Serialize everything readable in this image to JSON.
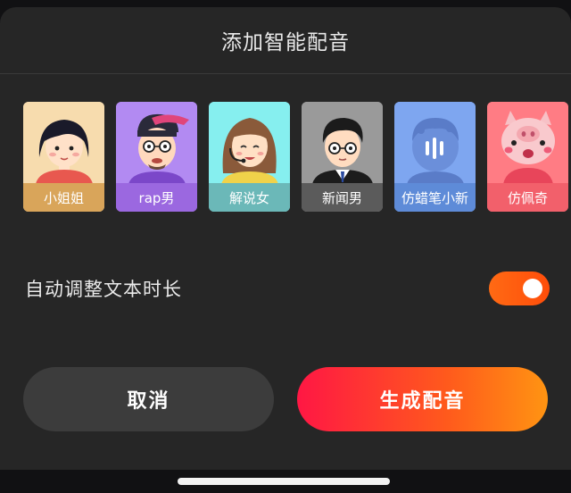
{
  "sheet": {
    "title": "添加智能配音"
  },
  "voices": [
    {
      "label": "小姐姐",
      "icon": "girl-avatar-icon",
      "label_bg": "#d9a55a"
    },
    {
      "label": "rap男",
      "icon": "rapper-avatar-icon",
      "label_bg": "#9b68e0"
    },
    {
      "label": "解说女",
      "icon": "commentator-avatar-icon",
      "label_bg": "#6bb8b8"
    },
    {
      "label": "新闻男",
      "icon": "news-anchor-avatar-icon",
      "label_bg": "#5b5b5b"
    },
    {
      "label": "仿蜡笔小新",
      "icon": "crayon-shinchan-avatar-icon",
      "label_bg": "#5e8bd8"
    },
    {
      "label": "仿佩奇",
      "icon": "peppa-avatar-icon",
      "label_bg": "#f2606b"
    }
  ],
  "auto_adjust": {
    "label": "自动调整文本时长",
    "enabled": true
  },
  "actions": {
    "cancel_label": "取消",
    "generate_label": "生成配音"
  },
  "colors": {
    "accent_orange": "#ff5a10",
    "gradient_start": "#ff1744",
    "gradient_end": "#ff9412"
  }
}
